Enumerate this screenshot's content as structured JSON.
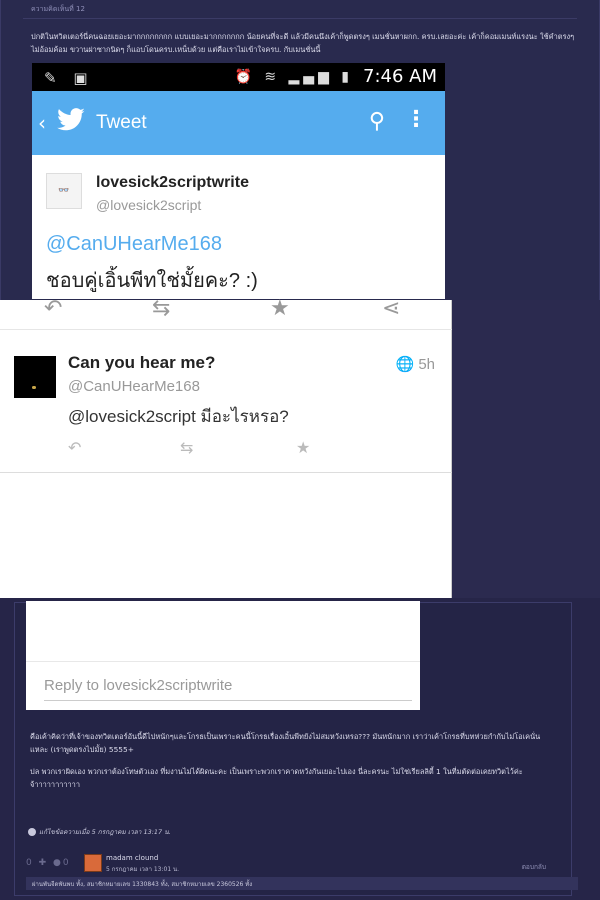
{
  "forum": {
    "comment_number": "ความคิดเห็นที่ 12",
    "opening_text": "ปกติในทวิตเตอร์นี่คนฉอยเยอะมากกกกกกกก แบบเยอะมากกกกกกก น้อยคนที่จะดี แล้วมีคนนึงเค้าก็พูดตรงๆ เมนชั่นหาผกก. ครบ.เลยอะค่ะ เค้าก็คอมเมนท์แรงนะ ใช้คำตรงๆไม่อ้อมค้อม ขวานผ่าซากนิดๆ ก็แอบโดนครบ.เหน็บด้วย แต่คือเราไม่เข้าใจครบ. กับเมนชั่นนี้",
    "comment_text": "คือเค้าคิดว่าที่เจ้าของทวิตเตอร์อันนี้ดีไปหนักๆและโกรธเป็นเพราะคนนี้โกรธเรื่องเอิ้นพีทยังไม่สมหวังเหรอ??? มันหนักมาก เราว่าเค้าโกรธที่บทห่วยกำกับไม่โอเคนั่นแหละ (เราพูดตรงไปมั้ย) 5555+",
    "comment_text_2": "ปล พวกเราผิดเอง พวกเราต้องโทษตัวเอง ที่มงานไม่ได้ผิดนะคะ เป็นเพราะพวกเราคาดหวังกันเยอะไปเอง นี่ละครนะ ไม่ใช่เรียลลิตี้ 1 ในที่มตัดต่อเคยทวิตไว้ค่ะ",
    "comment_text_3": "จ้าาาาาาาาาาา",
    "edited_note": "แก้ไขข้อความเมื่อ 5 กรกฎาคม เวลา 13:17 น.",
    "vote_icons": "0 ✚ ●0",
    "user_name": "madam clound",
    "user_date": "5 กรกฎาคม เวลา 13:01 น.",
    "reply_link": "ตอบกลับ",
    "footer_text": "ผ่านพันจีดพันพบ ทั้ง, สมาชิกหมายเลข 1330843 ทั้ง, สมาชิกหมายเลข 2360526 ทั้ง"
  },
  "phone": {
    "time": "7:46 AM",
    "app_title": "Tweet"
  },
  "tweet_main": {
    "name": "lovesick2scriptwrite",
    "handle": "@lovesick2script",
    "mention": "@CanUHearMe168",
    "body": "ชอบคู่เอิ้นพีทใช่มั้ยคะ? :)"
  },
  "tweet_reply": {
    "name": "Can you hear me?",
    "handle": "@CanUHearMe168",
    "time": "5h",
    "mention": "@lovesick2script",
    "body": " มีอะไรหรอ?"
  },
  "reply_box": {
    "placeholder": "Reply to lovesick2scriptwrite"
  },
  "colors": {
    "twitter_blue": "#55acee",
    "forum_bg": "#2b2a4f"
  },
  "icons": [
    "reply-icon",
    "retweet-icon",
    "favorite-icon",
    "share-icon",
    "search-icon",
    "more-icon",
    "globe-icon"
  ]
}
